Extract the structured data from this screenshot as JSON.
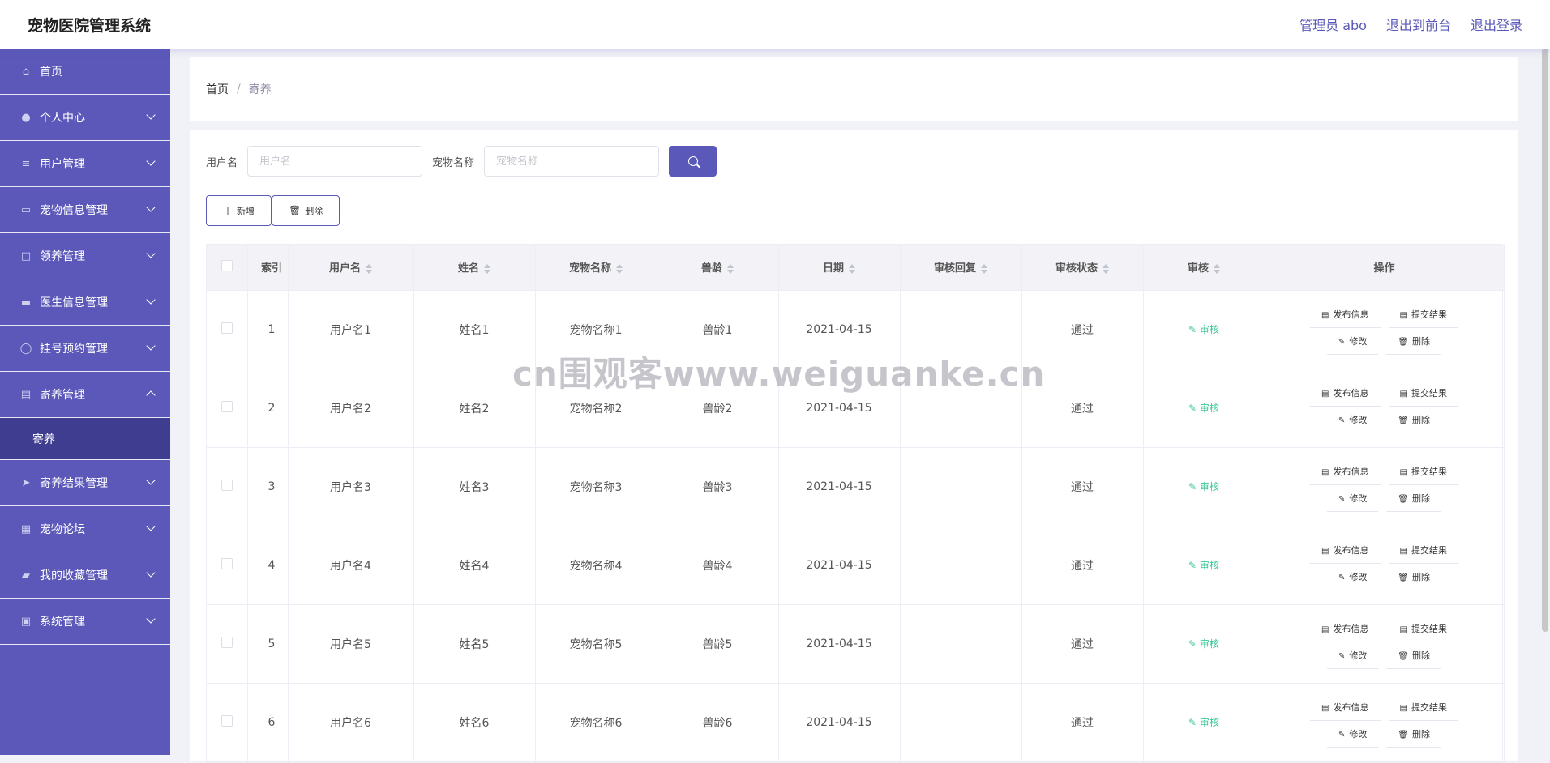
{
  "header": {
    "title": "宠物医院管理系统",
    "admin_label": "管理员 abo",
    "front_link": "退出到前台",
    "logout_link": "退出登录"
  },
  "sidebar": {
    "items": [
      {
        "label": "首页",
        "icon": "home-icon",
        "expandable": false
      },
      {
        "label": "个人中心",
        "icon": "user-icon",
        "expandable": true
      },
      {
        "label": "用户管理",
        "icon": "list-icon",
        "expandable": true
      },
      {
        "label": "宠物信息管理",
        "icon": "chat-icon",
        "expandable": true
      },
      {
        "label": "领养管理",
        "icon": "comment-icon",
        "expandable": true
      },
      {
        "label": "医生信息管理",
        "icon": "board-icon",
        "expandable": true
      },
      {
        "label": "挂号预约管理",
        "icon": "power-icon",
        "expandable": true
      },
      {
        "label": "寄养管理",
        "icon": "clipboard-icon",
        "expandable": true,
        "open": true
      },
      {
        "label": "寄养结果管理",
        "icon": "send-icon",
        "expandable": true
      },
      {
        "label": "宠物论坛",
        "icon": "grid-icon",
        "expandable": true
      },
      {
        "label": "我的收藏管理",
        "icon": "ticket-icon",
        "expandable": true
      },
      {
        "label": "系统管理",
        "icon": "box-icon",
        "expandable": true
      }
    ],
    "submenu_active": "寄养"
  },
  "breadcrumb": {
    "home": "首页",
    "separator": "/",
    "current": "寄养"
  },
  "search": {
    "username_label": "用户名",
    "username_placeholder": "用户名",
    "petname_label": "宠物名称",
    "petname_placeholder": "宠物名称"
  },
  "actions": {
    "add": "新增",
    "delete": "删除"
  },
  "table": {
    "headers": {
      "index": "索引",
      "username": "用户名",
      "name": "姓名",
      "petname": "宠物名称",
      "age": "兽龄",
      "date": "日期",
      "reply": "审核回复",
      "status": "审核状态",
      "audit": "审核",
      "ops": "操作"
    },
    "rows": [
      {
        "index": "1",
        "username": "用户名1",
        "name": "姓名1",
        "petname": "宠物名称1",
        "age": "兽龄1",
        "date": "2021-04-15",
        "reply": "",
        "status": "通过",
        "audit": "审核"
      },
      {
        "index": "2",
        "username": "用户名2",
        "name": "姓名2",
        "petname": "宠物名称2",
        "age": "兽龄2",
        "date": "2021-04-15",
        "reply": "",
        "status": "通过",
        "audit": "审核"
      },
      {
        "index": "3",
        "username": "用户名3",
        "name": "姓名3",
        "petname": "宠物名称3",
        "age": "兽龄3",
        "date": "2021-04-15",
        "reply": "",
        "status": "通过",
        "audit": "审核"
      },
      {
        "index": "4",
        "username": "用户名4",
        "name": "姓名4",
        "petname": "宠物名称4",
        "age": "兽龄4",
        "date": "2021-04-15",
        "reply": "",
        "status": "通过",
        "audit": "审核"
      },
      {
        "index": "5",
        "username": "用户名5",
        "name": "姓名5",
        "petname": "宠物名称5",
        "age": "兽龄5",
        "date": "2021-04-15",
        "reply": "",
        "status": "通过",
        "audit": "审核"
      },
      {
        "index": "6",
        "username": "用户名6",
        "name": "姓名6",
        "petname": "宠物名称6",
        "age": "兽龄6",
        "date": "2021-04-15",
        "reply": "",
        "status": "通过",
        "audit": "审核"
      }
    ],
    "op_labels": {
      "publish": "发布信息",
      "submit": "提交结果",
      "edit": "修改",
      "delete": "删除"
    }
  },
  "watermark": "cn围观客www.weiguanke.cn",
  "colors": {
    "accent": "#5a58b8",
    "sidebar_bg": "#5b58b9",
    "sidebar_active": "#3f3d8f",
    "audit_link": "#3ec79b"
  }
}
